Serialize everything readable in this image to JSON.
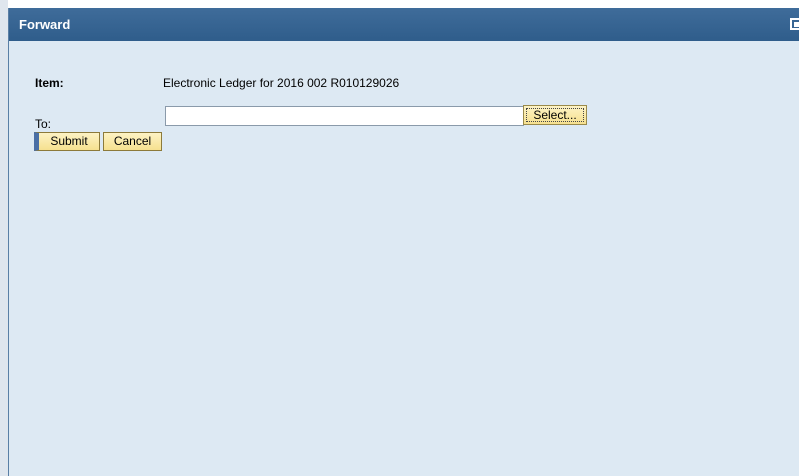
{
  "dialog": {
    "title": "Forward",
    "maximize_icon": "maximize-icon"
  },
  "form": {
    "item_label": "Item:",
    "item_value": "Electronic Ledger for 2016 002 R010129026",
    "to_label": "To:",
    "to_value": "",
    "to_placeholder": ""
  },
  "buttons": {
    "select_label": "Select...",
    "submit_label": "Submit",
    "cancel_label": "Cancel"
  },
  "colors": {
    "titlebar": "#2f5d8b",
    "dialog_background": "#dde9f3",
    "button_background": "#f6e08f"
  }
}
